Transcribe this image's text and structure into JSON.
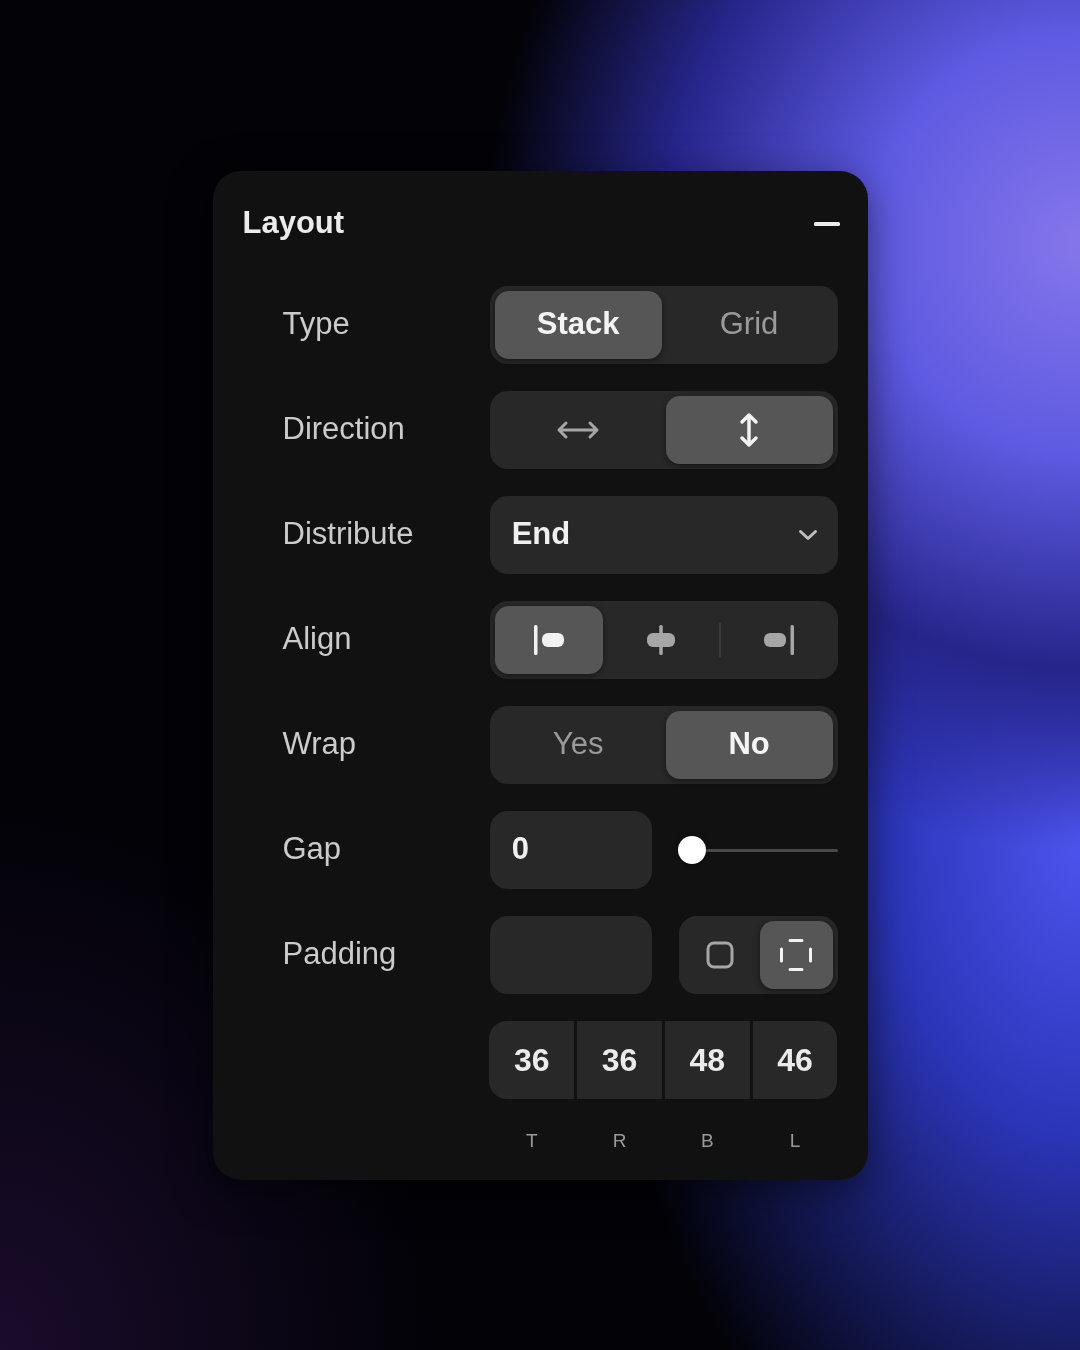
{
  "panel": {
    "title": "Layout"
  },
  "rows": [
    {
      "kind": "segmented",
      "label": "Type",
      "options": [
        {
          "label": "Stack",
          "selected": true
        },
        {
          "label": "Grid",
          "selected": false
        }
      ]
    },
    {
      "kind": "icon_segmented",
      "label": "Direction",
      "options": [
        {
          "kind": "horizontal",
          "selected": false
        },
        {
          "kind": "vertical",
          "selected": true
        }
      ]
    },
    {
      "kind": "dropdown",
      "label": "Distribute",
      "value": "End"
    },
    {
      "kind": "icon_segmented",
      "label": "Align",
      "options": [
        {
          "kind": "left",
          "selected": true
        },
        {
          "kind": "center",
          "selected": false
        },
        {
          "kind": "right",
          "selected": false
        }
      ]
    },
    {
      "kind": "segmented",
      "label": "Wrap",
      "options": [
        {
          "label": "Yes",
          "selected": false
        },
        {
          "label": "No",
          "selected": true
        }
      ]
    },
    {
      "kind": "slider",
      "label": "Gap",
      "value": "0",
      "level": 0
    },
    {
      "kind": "padding",
      "label": "Padding",
      "modes": [
        {
          "kind": "uniform",
          "selected": false
        },
        {
          "kind": "individual",
          "selected": true
        }
      ],
      "sides": [
        {
          "value": "36",
          "label": "T"
        },
        {
          "value": "36",
          "label": "R"
        },
        {
          "value": "48",
          "label": "B"
        },
        {
          "value": "46",
          "label": "L"
        }
      ]
    }
  ]
}
